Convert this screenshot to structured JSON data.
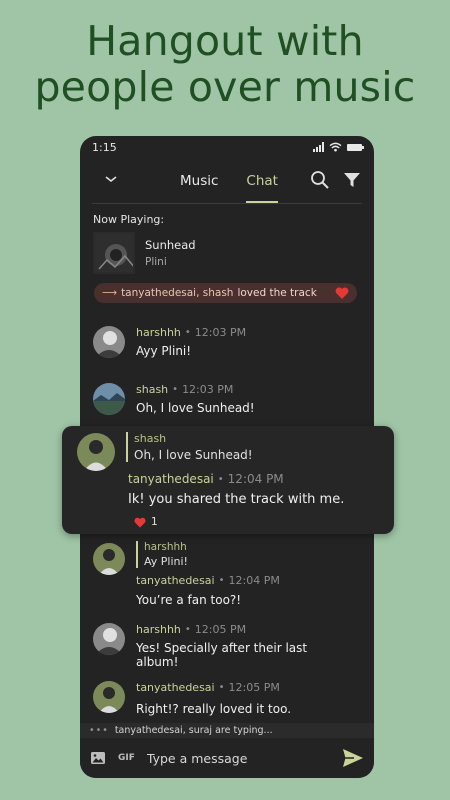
{
  "promo": {
    "line1": "Hangout with",
    "line2": "people over music"
  },
  "status_bar": {
    "time": "1:15"
  },
  "tabs": [
    {
      "label": "Music",
      "active": false
    },
    {
      "label": "Chat",
      "active": true
    }
  ],
  "now_playing": {
    "label": "Now Playing:",
    "title": "Sunhead",
    "artist": "Plini"
  },
  "loved_banner": {
    "arrow": "⟶",
    "names": "tanyathedesai, shash",
    "text": "loved the track",
    "icon": "heart-icon"
  },
  "messages": [
    {
      "user": "harshhh",
      "time": "12:03 PM",
      "text": "Ayy Plini!"
    },
    {
      "user": "shash",
      "time": "12:03 PM",
      "text": "Oh, I love Sunhead!"
    }
  ],
  "popup_message": {
    "quote_user": "shash",
    "quote_text": "Oh, I love Sunhead!",
    "user": "tanyathedesai",
    "time": "12:04 PM",
    "text": "Ik! you shared the track with me.",
    "reaction_count": "1"
  },
  "messages_after": [
    {
      "quote_user": "harshhh",
      "quote_text": "Ay Plini!",
      "user": "tanyathedesai",
      "time": "12:04 PM",
      "text": "You’re a fan too?!"
    },
    {
      "user": "harshhh",
      "time": "12:05 PM",
      "text_line1": "Yes! Specially after their last",
      "text_line2": "album!"
    },
    {
      "user": "tanyathedesai",
      "time": "12:05 PM",
      "text": "Right!? really loved it too."
    }
  ],
  "typing": {
    "text": "tanyathedesai, suraj are typing..."
  },
  "composer": {
    "gif_label": "GIF",
    "placeholder": "Type a message"
  },
  "colors": {
    "background": "#9fc5a6",
    "title_green": "#1f4f22",
    "accent": "#c9d39a",
    "heart": "#e53935",
    "phone_bg": "#232323"
  }
}
